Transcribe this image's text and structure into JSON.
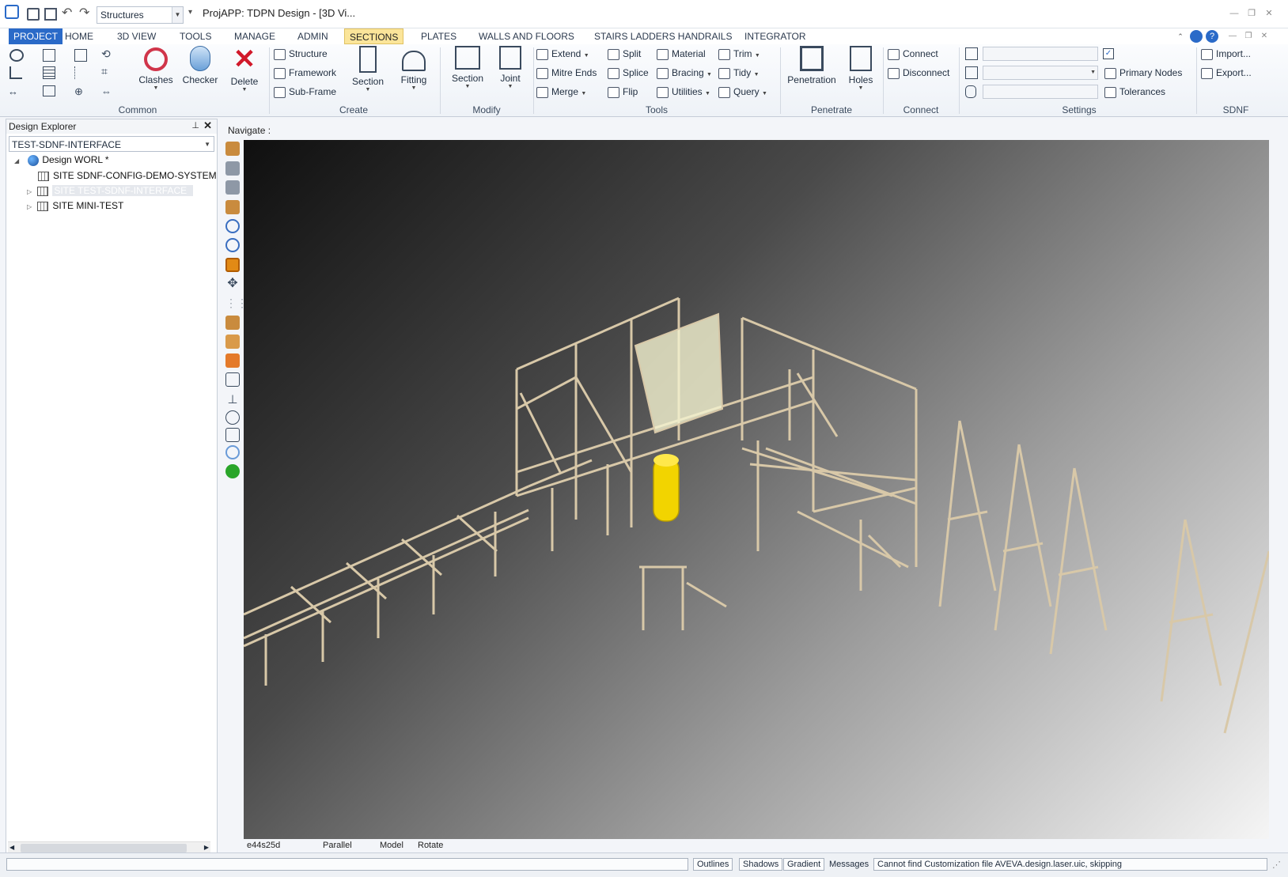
{
  "app": {
    "title": "ProjAPP: TDPN Design - [3D Vi...",
    "quick_combo": "Structures"
  },
  "tabs": [
    "PROJECT",
    "HOME",
    "3D VIEW",
    "TOOLS",
    "MANAGE",
    "ADMIN",
    "SECTIONS",
    "PLATES",
    "WALLS AND FLOORS",
    "STAIRS LADDERS HANDRAILS",
    "INTEGRATOR"
  ],
  "ribbon": {
    "common": {
      "label": "Common",
      "clashes": "Clashes",
      "checker": "Checker",
      "delete": "Delete"
    },
    "create": {
      "label": "Create",
      "structure": "Structure",
      "framework": "Framework",
      "subframe": "Sub-Frame",
      "section": "Section",
      "fitting": "Fitting"
    },
    "modify": {
      "label": "Modify",
      "section": "Section",
      "joint": "Joint"
    },
    "tools": {
      "label": "Tools",
      "extend": "Extend",
      "mitre_ends": "Mitre Ends",
      "merge": "Merge",
      "split": "Split",
      "splice": "Splice",
      "flip": "Flip",
      "material": "Material",
      "bracing": "Bracing",
      "utilities": "Utilities",
      "trim": "Trim",
      "tidy": "Tidy",
      "query": "Query"
    },
    "penetrate": {
      "label": "Penetrate",
      "penetration": "Penetration",
      "holes": "Holes"
    },
    "connect": {
      "label": "Connect",
      "connect": "Connect",
      "disconnect": "Disconnect"
    },
    "settings": {
      "label": "Settings",
      "primary_nodes": "Primary Nodes",
      "tolerances": "Tolerances"
    },
    "sdnf": {
      "label": "SDNF",
      "import": "Import...",
      "export": "Export..."
    }
  },
  "explorer": {
    "title": "Design Explorer",
    "combo": "TEST-SDNF-INTERFACE",
    "tree": [
      "Design WORL *",
      "SITE SDNF-CONFIG-DEMO-SYSTEM",
      "SITE TEST-SDNF-INTERFACE",
      "SITE MINI-TEST"
    ]
  },
  "viewport": {
    "navigate_label": "Navigate :",
    "status": [
      "e44s25d",
      "Parallel",
      "Model",
      "Rotate"
    ]
  },
  "statusbar": {
    "outlines": "Outlines",
    "shadows": "Shadows",
    "gradient": "Gradient",
    "messages": "Messages",
    "message_text": "Cannot find Customization file AVEVA.design.laser.uic, skipping"
  },
  "colors": {
    "accent": "#2a6ac8",
    "selected_tab": "#fbe59a",
    "steel": "#d8c8a8",
    "vessel": "#f2d400"
  }
}
